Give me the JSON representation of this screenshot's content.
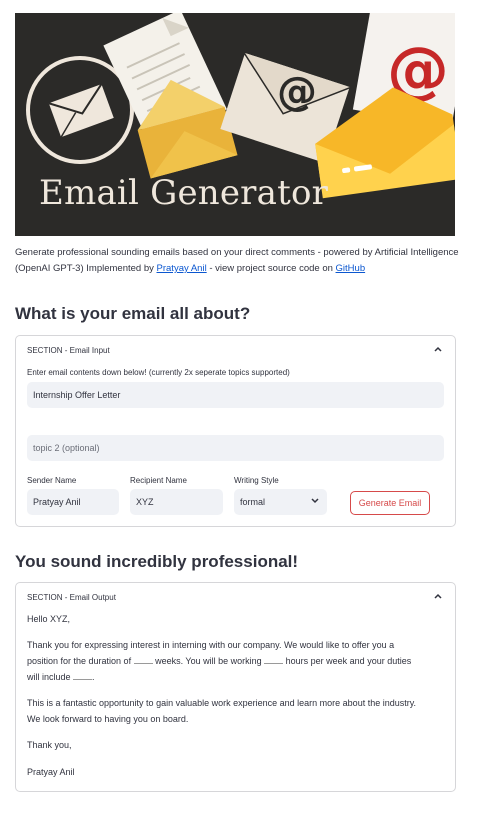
{
  "banner": {
    "title": "Email Generator"
  },
  "description": {
    "text_before_author": "Generate professional sounding emails based on your direct comments - powered by Artificial Intelligence (OpenAI GPT-3) Implemented by ",
    "author_link": "Pratyay Anil",
    "text_middle": " - view project source code on ",
    "github_link": "GitHub"
  },
  "input_section": {
    "heading": "What is your email all about?",
    "expander_title": "SECTION - Email Input",
    "instructions": "Enter email contents down below! (currently 2x seperate topics supported)",
    "topic1_value": "Internship Offer Letter",
    "topic2_placeholder": "topic 2 (optional)",
    "sender_label": "Sender Name",
    "sender_value": "Pratyay Anil",
    "recipient_label": "Recipient Name",
    "recipient_value": "XYZ",
    "style_label": "Writing Style",
    "style_value": "formal",
    "generate_label": "Generate Email"
  },
  "output_section": {
    "heading": "You sound incredibly professional!",
    "expander_title": "SECTION - Email Output",
    "greeting": "Hello XYZ,",
    "p1_line1": "Thank you for expressing interest in interning with our company. We would like to offer you a",
    "p1_line2_a": "position for the duration of ",
    "p1_line2_b": " weeks. You will be working ",
    "p1_line2_c": " hours per week and your duties",
    "p1_line3_a": "will include ",
    "p1_line3_b": ".",
    "p2_line1": "This is a fantastic opportunity to gain valuable work experience and learn more about the industry.",
    "p2_line2": "We look forward to having you on board.",
    "closing": "Thank you,",
    "signature": "Pratyay Anil"
  }
}
